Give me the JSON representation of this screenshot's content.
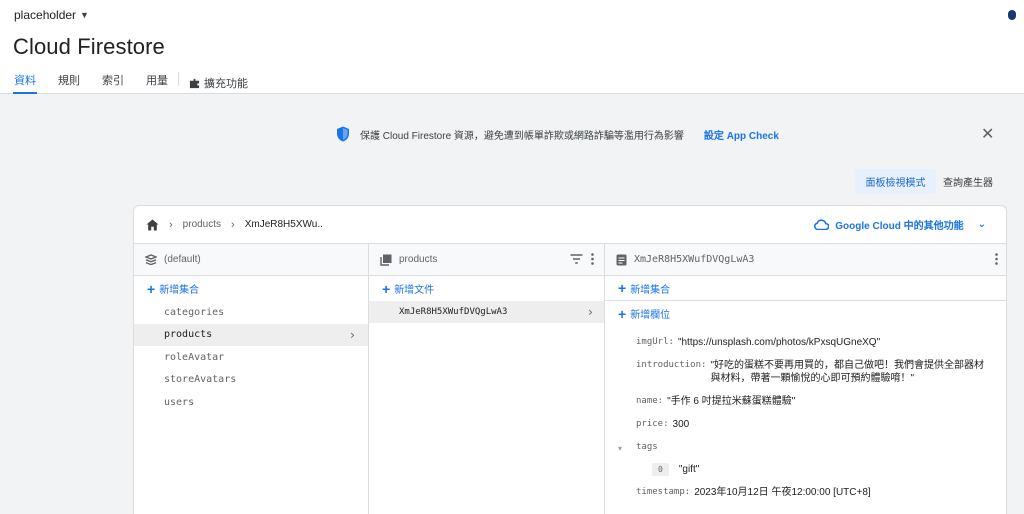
{
  "header": {
    "project": "placeholder",
    "title": "Cloud Firestore",
    "tabs": [
      "資料",
      "規則",
      "索引",
      "用量"
    ],
    "extensions": "擴充功能"
  },
  "banner": {
    "text": "保護 Cloud Firestore 資源，避免遭到帳單詐欺或網路詐騙等濫用行為影響",
    "link": "設定 App Check"
  },
  "view": {
    "panel_mode": "面板檢視模式",
    "query_builder": "查詢產生器"
  },
  "breadcrumb": {
    "collection": "products",
    "document": "XmJeR8H5XWu.."
  },
  "google_cloud": "Google Cloud 中的其他功能",
  "col1": {
    "header": "(default)",
    "add": "新增集合",
    "items": [
      "categories",
      "products",
      "roleAvatar",
      "storeAvatars",
      "users"
    ],
    "selected_index": 1
  },
  "col2": {
    "header": "products",
    "add": "新增文件",
    "doc": "XmJeR8H5XWufDVQgLwA3"
  },
  "col3": {
    "header": "XmJeR8H5XWufDVQgLwA3",
    "add_collection": "新增集合",
    "add_field": "新增欄位",
    "fields": {
      "imgurl_key": "imgUrl:",
      "imgurl_val": "\"https://unsplash.com/photos/kPxsqUGneXQ\"",
      "intro_key": "introduction:",
      "intro_val": "\"好吃的蛋糕不要再用買的，都自己做吧！我們會提供全部器材與材料，帶著一顆愉悅的心即可預約體驗唷！\"",
      "name_key": "name:",
      "name_val": "\"手作 6 吋提拉米蘇蛋糕體驗\"",
      "price_key": "price:",
      "price_val": "300",
      "tags_key": "tags",
      "tags_index": "0",
      "tags_value": "\"gift\"",
      "timestamp_key": "timestamp:",
      "timestamp_val": "2023年10月12日 午夜12:00:00 [UTC+8]"
    }
  },
  "colors": {
    "accent": "#1a73e8",
    "selected_bg": "#eeeeee",
    "header_bg": "#f8f9fa",
    "border": "#dadce0"
  }
}
